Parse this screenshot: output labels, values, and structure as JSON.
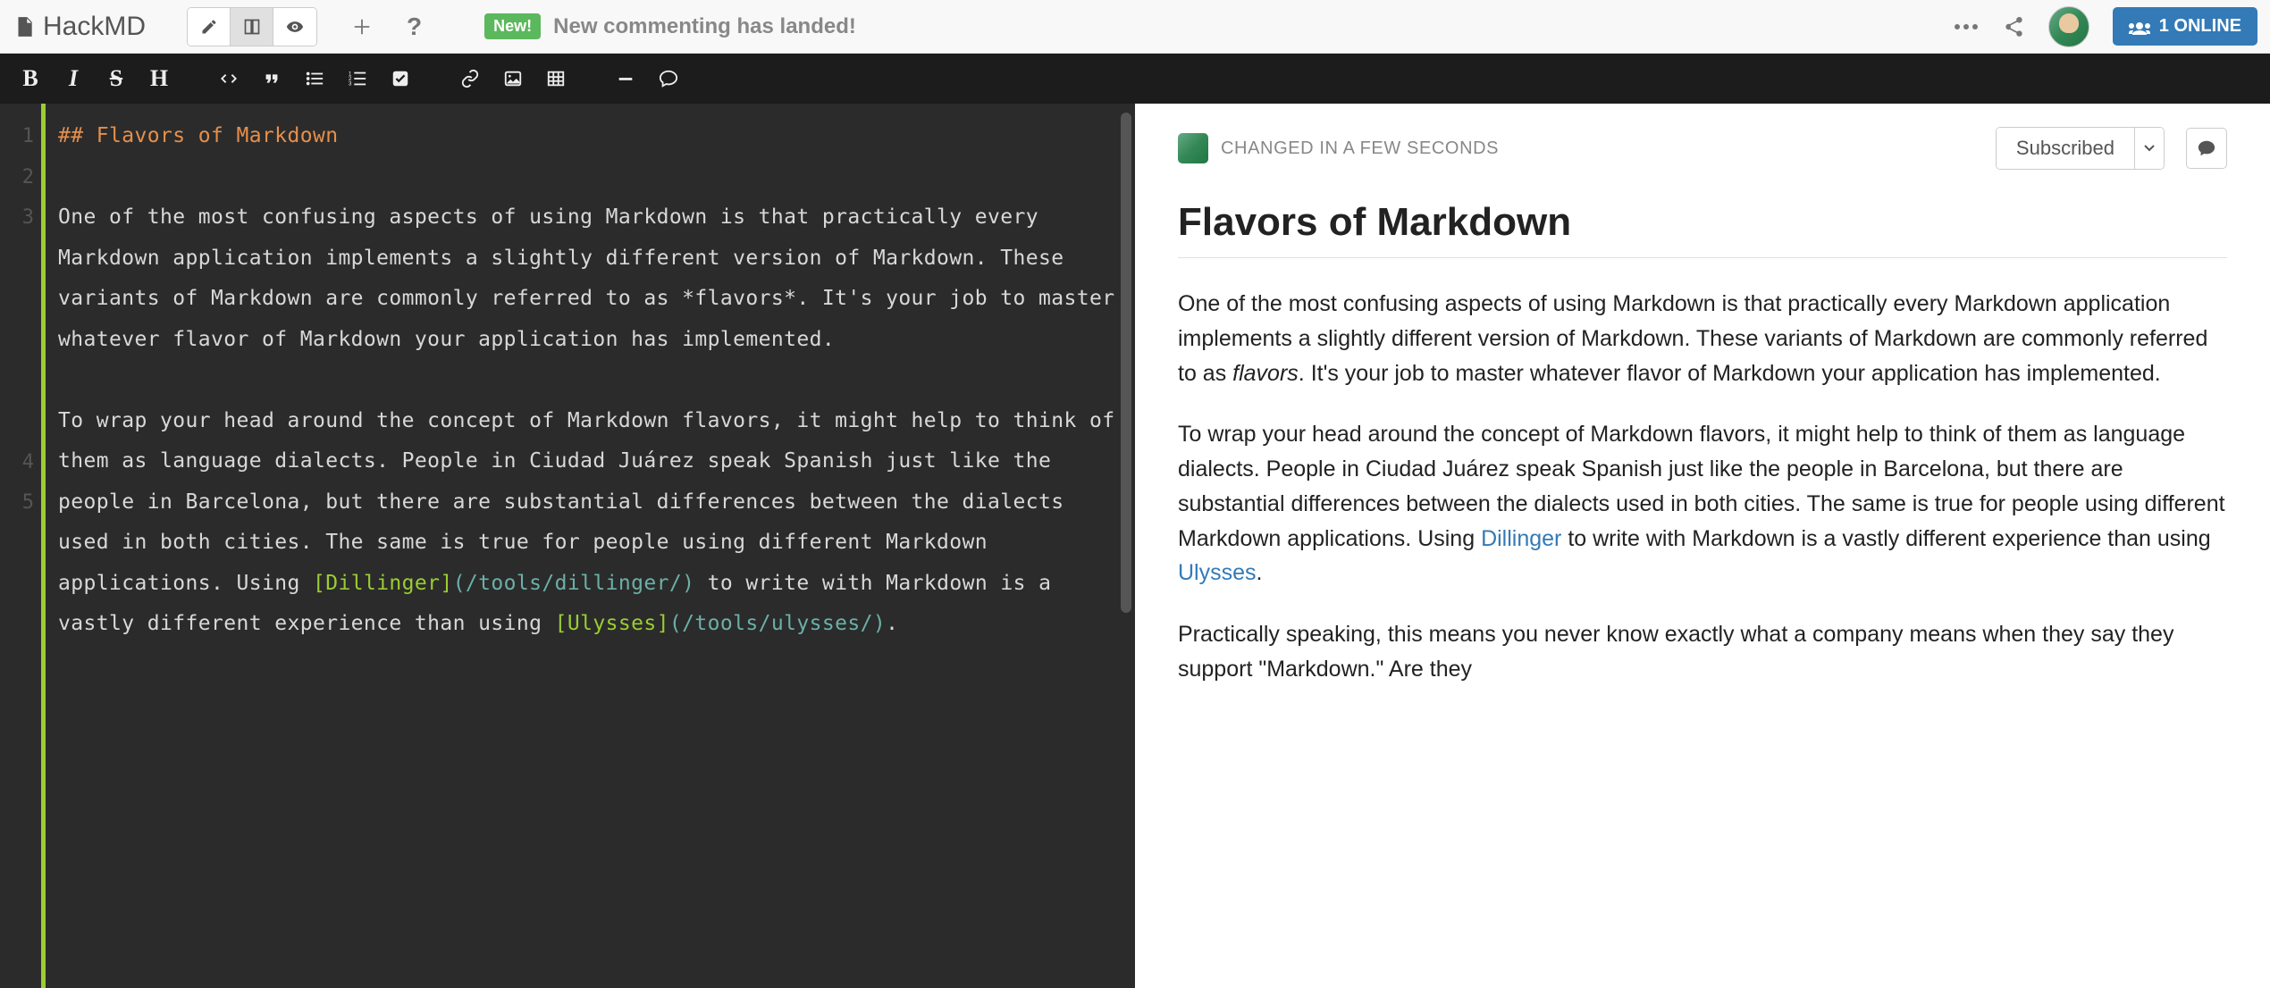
{
  "header": {
    "logo_text": "HackMD",
    "new_badge": "New!",
    "news_text": "New commenting has landed!",
    "online_label": "1 ONLINE"
  },
  "editor": {
    "line_numbers": [
      "1",
      "2",
      "3",
      "",
      "4",
      "5"
    ],
    "lines": {
      "l1_head": "## Flavors of Markdown",
      "l2": "",
      "l3": "One of the most confusing aspects of using Markdown is that practically every Markdown application implements a slightly different version of Markdown. These variants of Markdown are commonly referred to as *flavors*. It's your job to master whatever flavor of Markdown your application has implemented.",
      "l4": "",
      "l5_pre": "To wrap your head around the concept of Markdown flavors, it might help to think of them as language dialects. People in Ciudad Juárez speak Spanish just like the people in Barcelona, but there are substantial differences between the dialects used in both cities. The same is true for people using different Markdown applications. Using ",
      "l5_link1_text": "[Dillinger]",
      "l5_link1_url": "(/tools/dillinger/)",
      "l5_mid": " to write with Markdown is a vastly different experience than using ",
      "l5_link2_text": "[Ulysses]",
      "l5_link2_url": "(/tools/ulysses/)",
      "l5_post": "."
    }
  },
  "preview": {
    "status_text": "CHANGED IN A FEW SECONDS",
    "subscribe_label": "Subscribed",
    "title": "Flavors of Markdown",
    "p1_pre": "One of the most confusing aspects of using Markdown is that practically every Markdown application implements a slightly different version of Markdown. These variants of Markdown are commonly referred to as ",
    "p1_em": "flavors",
    "p1_post": ". It's your job to master whatever flavor of Markdown your application has implemented.",
    "p2_pre": "To wrap your head around the concept of Markdown flavors, it might help to think of them as language dialects. People in Ciudad Juárez speak Spanish just like the people in Barcelona, but there are substantial differences between the dialects used in both cities. The same is true for people using different Markdown applications. Using ",
    "p2_link1": "Dillinger",
    "p2_mid": " to write with Markdown is a vastly different experience than using ",
    "p2_link2": "Ulysses",
    "p2_post": ".",
    "p3": "Practically speaking, this means you never know exactly what a company means when they say they support \"Markdown.\" Are they"
  }
}
